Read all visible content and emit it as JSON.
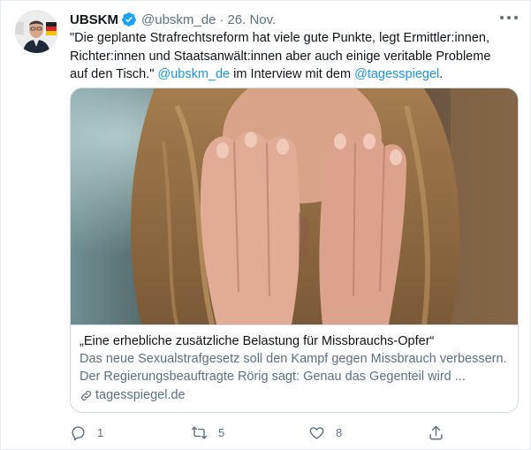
{
  "tweet": {
    "author_name": "UBSKM",
    "handle": "@ubskm_de",
    "separator": "·",
    "date": "26. Nov.",
    "text_part1": "\"Die geplante Strafrechtsreform hat viele gute Punkte, legt Ermittler:innen, Richter:innen und Staatsanwält:innen aber auch einige veritable Probleme auf den Tisch.\" ",
    "mention1": "@ubskm_de",
    "text_part2": " im Interview mit dem ",
    "mention2": "@tagesspiegel",
    "text_part3": "."
  },
  "card": {
    "title": "„Eine erhebliche zusätzliche Belastung für Missbrauchs-Opfer“",
    "description": "Das neue Sexualstrafgesetz soll den Kampf gegen Missbrauch verbessern. Der Regierungsbeauftragte Rörig sagt: Genau das Gegenteil wird ...",
    "domain": "tagesspiegel.de"
  },
  "actions": {
    "reply_count": "1",
    "retweet_count": "5",
    "like_count": "8"
  },
  "colors": {
    "link": "#1b95e0",
    "secondary_text": "#5b7083",
    "verified_badge": "#1da1f2",
    "border": "#cfd9de"
  },
  "icons": [
    "verified-badge-icon",
    "more-icon",
    "link-icon",
    "reply-icon",
    "retweet-icon",
    "like-icon",
    "share-icon"
  ]
}
